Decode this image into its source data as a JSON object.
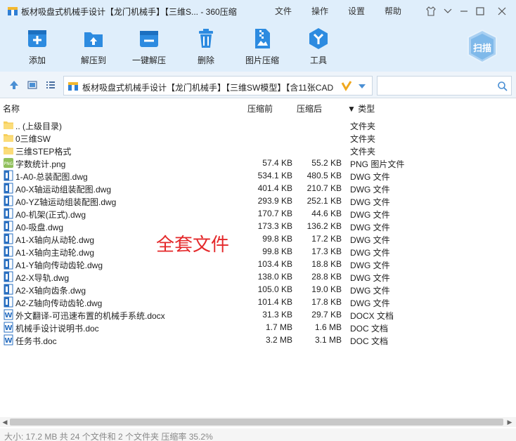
{
  "window": {
    "title": "板材吸盘式机械手设计【龙门机械手】【三维S... - 360压缩",
    "menu": [
      "文件",
      "操作",
      "设置",
      "帮助"
    ]
  },
  "toolbar": [
    {
      "label": "添加",
      "icon": "add-icon"
    },
    {
      "label": "解压到",
      "icon": "extract-to-icon"
    },
    {
      "label": "一键解压",
      "icon": "one-click-extract-icon"
    },
    {
      "label": "删除",
      "icon": "delete-icon"
    },
    {
      "label": "图片压缩",
      "icon": "image-compress-icon"
    },
    {
      "label": "工具",
      "icon": "tools-icon"
    }
  ],
  "scan_label": "扫描",
  "address": {
    "path": "板材吸盘式机械手设计【龙门机械手】【三维SW模型】【含11张CAD",
    "search_placeholder": ""
  },
  "columns": {
    "name": "名称",
    "size": "压缩前",
    "compressed": "压缩后",
    "type": "▼ 类型"
  },
  "files": [
    {
      "name": ".. (上级目录)",
      "size": "",
      "compressed": "",
      "type": "文件夹",
      "icon": "folder"
    },
    {
      "name": "0三维SW",
      "size": "",
      "compressed": "",
      "type": "文件夹",
      "icon": "folder"
    },
    {
      "name": "三维STEP格式",
      "size": "",
      "compressed": "",
      "type": "文件夹",
      "icon": "folder"
    },
    {
      "name": "字数统计.png",
      "size": "57.4 KB",
      "compressed": "55.2 KB",
      "type": "PNG 图片文件",
      "icon": "png"
    },
    {
      "name": "1-A0-总装配图.dwg",
      "size": "534.1 KB",
      "compressed": "480.5 KB",
      "type": "DWG 文件",
      "icon": "dwg"
    },
    {
      "name": "A0-X轴运动组装配图.dwg",
      "size": "401.4 KB",
      "compressed": "210.7 KB",
      "type": "DWG 文件",
      "icon": "dwg"
    },
    {
      "name": "A0-YZ轴运动组装配图.dwg",
      "size": "293.9 KB",
      "compressed": "252.1 KB",
      "type": "DWG 文件",
      "icon": "dwg"
    },
    {
      "name": "A0-机架(正式).dwg",
      "size": "170.7 KB",
      "compressed": "44.6 KB",
      "type": "DWG 文件",
      "icon": "dwg"
    },
    {
      "name": "A0-吸盘.dwg",
      "size": "173.3 KB",
      "compressed": "136.2 KB",
      "type": "DWG 文件",
      "icon": "dwg"
    },
    {
      "name": "A1-X轴向从动轮.dwg",
      "size": "99.8 KB",
      "compressed": "17.2 KB",
      "type": "DWG 文件",
      "icon": "dwg"
    },
    {
      "name": "A1-X轴向主动轮.dwg",
      "size": "99.8 KB",
      "compressed": "17.3 KB",
      "type": "DWG 文件",
      "icon": "dwg"
    },
    {
      "name": "A1-Y轴向传动齿轮.dwg",
      "size": "103.4 KB",
      "compressed": "18.8 KB",
      "type": "DWG 文件",
      "icon": "dwg"
    },
    {
      "name": "A2-X导轨.dwg",
      "size": "138.0 KB",
      "compressed": "28.8 KB",
      "type": "DWG 文件",
      "icon": "dwg"
    },
    {
      "name": "A2-X轴向齿条.dwg",
      "size": "105.0 KB",
      "compressed": "19.0 KB",
      "type": "DWG 文件",
      "icon": "dwg"
    },
    {
      "name": "A2-Z轴向传动齿轮.dwg",
      "size": "101.4 KB",
      "compressed": "17.8 KB",
      "type": "DWG 文件",
      "icon": "dwg"
    },
    {
      "name": "外文翻译-可迅速布置的机械手系统.docx",
      "size": "31.3 KB",
      "compressed": "29.7 KB",
      "type": "DOCX 文档",
      "icon": "doc"
    },
    {
      "name": "机械手设计说明书.doc",
      "size": "1.7 MB",
      "compressed": "1.6 MB",
      "type": "DOC 文档",
      "icon": "doc"
    },
    {
      "name": "任务书.doc",
      "size": "3.2 MB",
      "compressed": "3.1 MB",
      "type": "DOC 文档",
      "icon": "doc"
    }
  ],
  "overlay_text": "全套文件",
  "status": "大小: 17.2 MB 共 24 个文件和 2 个文件夹 压缩率 35.2%"
}
